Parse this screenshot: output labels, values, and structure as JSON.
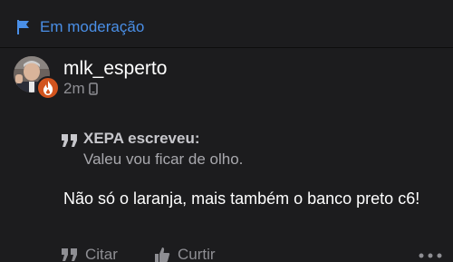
{
  "moderation": {
    "label": "Em moderação",
    "icon": "flag-icon",
    "color": "#4a8fe7"
  },
  "post": {
    "username": "mlk_esperto",
    "time": "2m",
    "device_icon": "mobile-icon",
    "quote": {
      "author": "XEPA escreveu:",
      "text": "Valeu vou ficar de olho."
    },
    "body": "Não só o laranja, mais também o banco preto c6!"
  },
  "actions": {
    "quote_label": "Citar",
    "like_label": "Curtir",
    "more_icon": "more-icon"
  },
  "colors": {
    "background": "#1c1c1e",
    "muted": "#8e8e93",
    "badge": "#d2541e"
  }
}
